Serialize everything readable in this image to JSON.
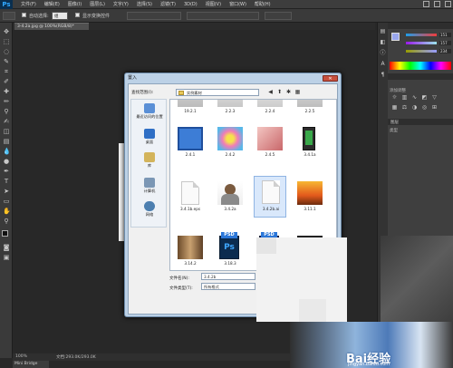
{
  "app": {
    "logo": "Ps"
  },
  "menubar": {
    "items": [
      "文件(F)",
      "编辑(E)",
      "图像(I)",
      "图层(L)",
      "文字(Y)",
      "选择(S)",
      "滤镜(T)",
      "3D(D)",
      "视图(V)",
      "窗口(W)",
      "帮助(H)"
    ]
  },
  "options": {
    "auto_select_label": "自动选择:",
    "layer_value": "组",
    "show_transform_label": "显示变换控件"
  },
  "document_tab": "3-4.2a.jpg @ 100%(RGB/8)*",
  "status": {
    "zoom": "100%",
    "doc_info": "文档:293.0K/293.0K",
    "bottom_tab": "Mini Bridge"
  },
  "panels": {
    "color_values": [
      "151",
      "157",
      "234"
    ],
    "adjustments_label": "添加调整",
    "layers_label": "图层",
    "kind_label": "类型"
  },
  "dialog": {
    "title": "置入",
    "close_label": "✕",
    "look_in_label": "查找范围(I):",
    "look_in_value": "实例素材",
    "places": [
      "最近访问的位置",
      "桌面",
      "库",
      "计算机",
      "网络"
    ],
    "files": [
      {
        "name": "19.2.1"
      },
      {
        "name": "2.2.3"
      },
      {
        "name": "2.2.4"
      },
      {
        "name": "2.2.5"
      },
      {
        "name": "2.4.1"
      },
      {
        "name": "2.4.2"
      },
      {
        "name": "2.4.5"
      },
      {
        "name": "3.4.1a"
      },
      {
        "name": "3.4.1b.eps"
      },
      {
        "name": "3.4.2a"
      },
      {
        "name": "3.4.2b.ai"
      },
      {
        "name": "3.11.1"
      },
      {
        "name": "3.14.2"
      },
      {
        "name": "3.18.3"
      }
    ],
    "file_name_label": "文件名(N):",
    "file_name_value": "3.4.2b",
    "file_type_label": "文件类型(T):",
    "file_type_value": "所有格式"
  },
  "watermark": {
    "text": "Bai经验",
    "sub": "jingyan.baidu.com"
  }
}
